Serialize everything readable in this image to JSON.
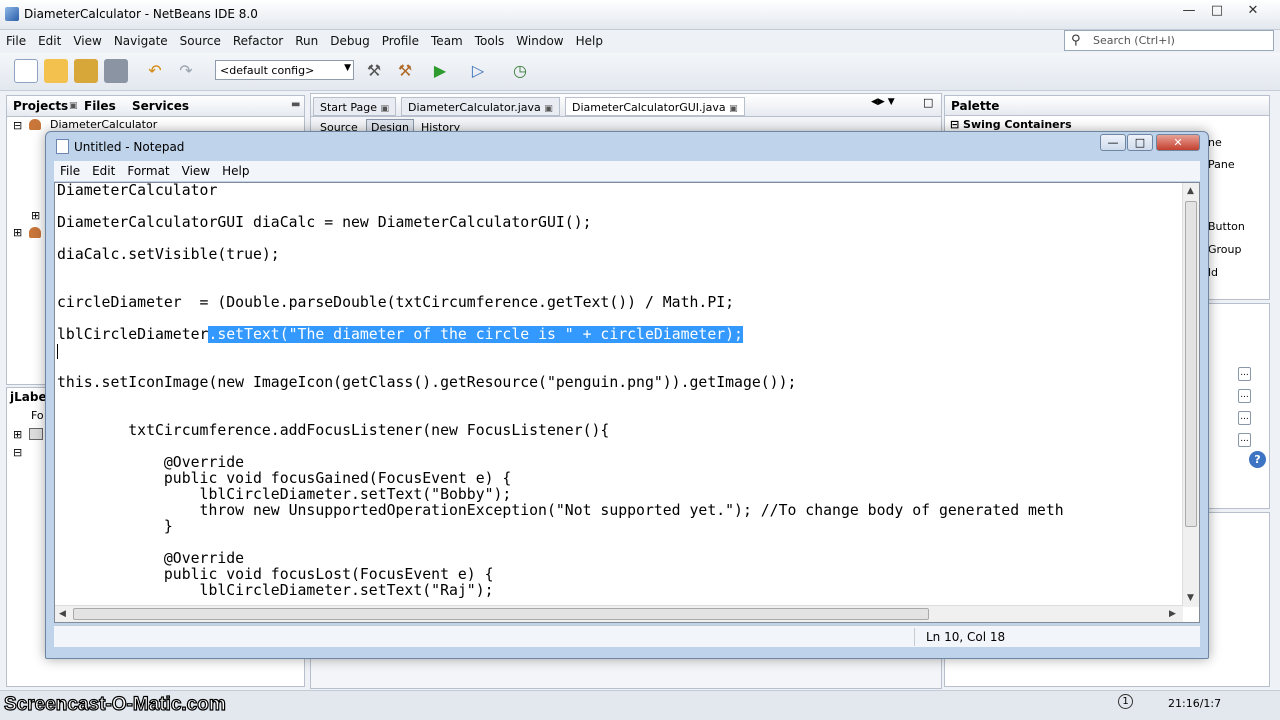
{
  "ide": {
    "title": "DiameterCalculator - NetBeans IDE 8.0",
    "menu": [
      "File",
      "Edit",
      "View",
      "Navigate",
      "Source",
      "Refactor",
      "Run",
      "Debug",
      "Profile",
      "Team",
      "Tools",
      "Window",
      "Help"
    ],
    "search_placeholder": "Search (Ctrl+I)",
    "config": "<default config>",
    "left_tabs": [
      "Projects",
      "Files",
      "Services"
    ],
    "project_name": "DiameterCalculator",
    "editor_tabs": [
      "Start Page",
      "DiameterCalculator.java",
      "DiameterCalculatorGUI.java"
    ],
    "view_tabs": [
      "Source",
      "Design",
      "History"
    ],
    "palette_title": "Palette",
    "palette_section": "Swing Containers",
    "palette_items": [
      "ne",
      "Pane",
      "Button",
      "Group",
      "ld"
    ],
    "navigator_title": "jLabel",
    "navigator_item": "Fo",
    "status_time": "21:16/1:7",
    "status_notif": "1"
  },
  "notepad": {
    "title": "Untitled - Notepad",
    "menu": [
      "File",
      "Edit",
      "Format",
      "View",
      "Help"
    ],
    "menu_mnemonics": [
      "F",
      "E",
      "o",
      "V",
      "H"
    ],
    "lines": [
      "DiameterCalculator",
      "DiameterCalculatorGUI diaCalc = new DiameterCalculatorGUI();",
      "diaCalc.setVisible(true);",
      "circleDiameter  = (Double.parseDouble(txtCircumference.getText()) / Math.PI;",
      "lblCircleDiameter",
      ".setText(\"The diameter of the circle is \" + circleDiameter);",
      "this.setIconImage(new ImageIcon(getClass().getResource(\"penguin.png\")).getImage());",
      "        txtCircumference.addFocusListener(new FocusListener(){",
      "            @Override",
      "            public void focusGained(FocusEvent e) {",
      "                lblCircleDiameter.setText(\"Bobby\");",
      "                throw new UnsupportedOperationException(\"Not supported yet.\"); //To change body of generated meth",
      "            }",
      "            @Override",
      "            public void focusLost(FocusEvent e) {",
      "                lblCircleDiameter.setText(\"Raj\");"
    ],
    "status_position": "Ln 10, Col 18"
  },
  "watermark": "Screencast-O-Matic.com"
}
